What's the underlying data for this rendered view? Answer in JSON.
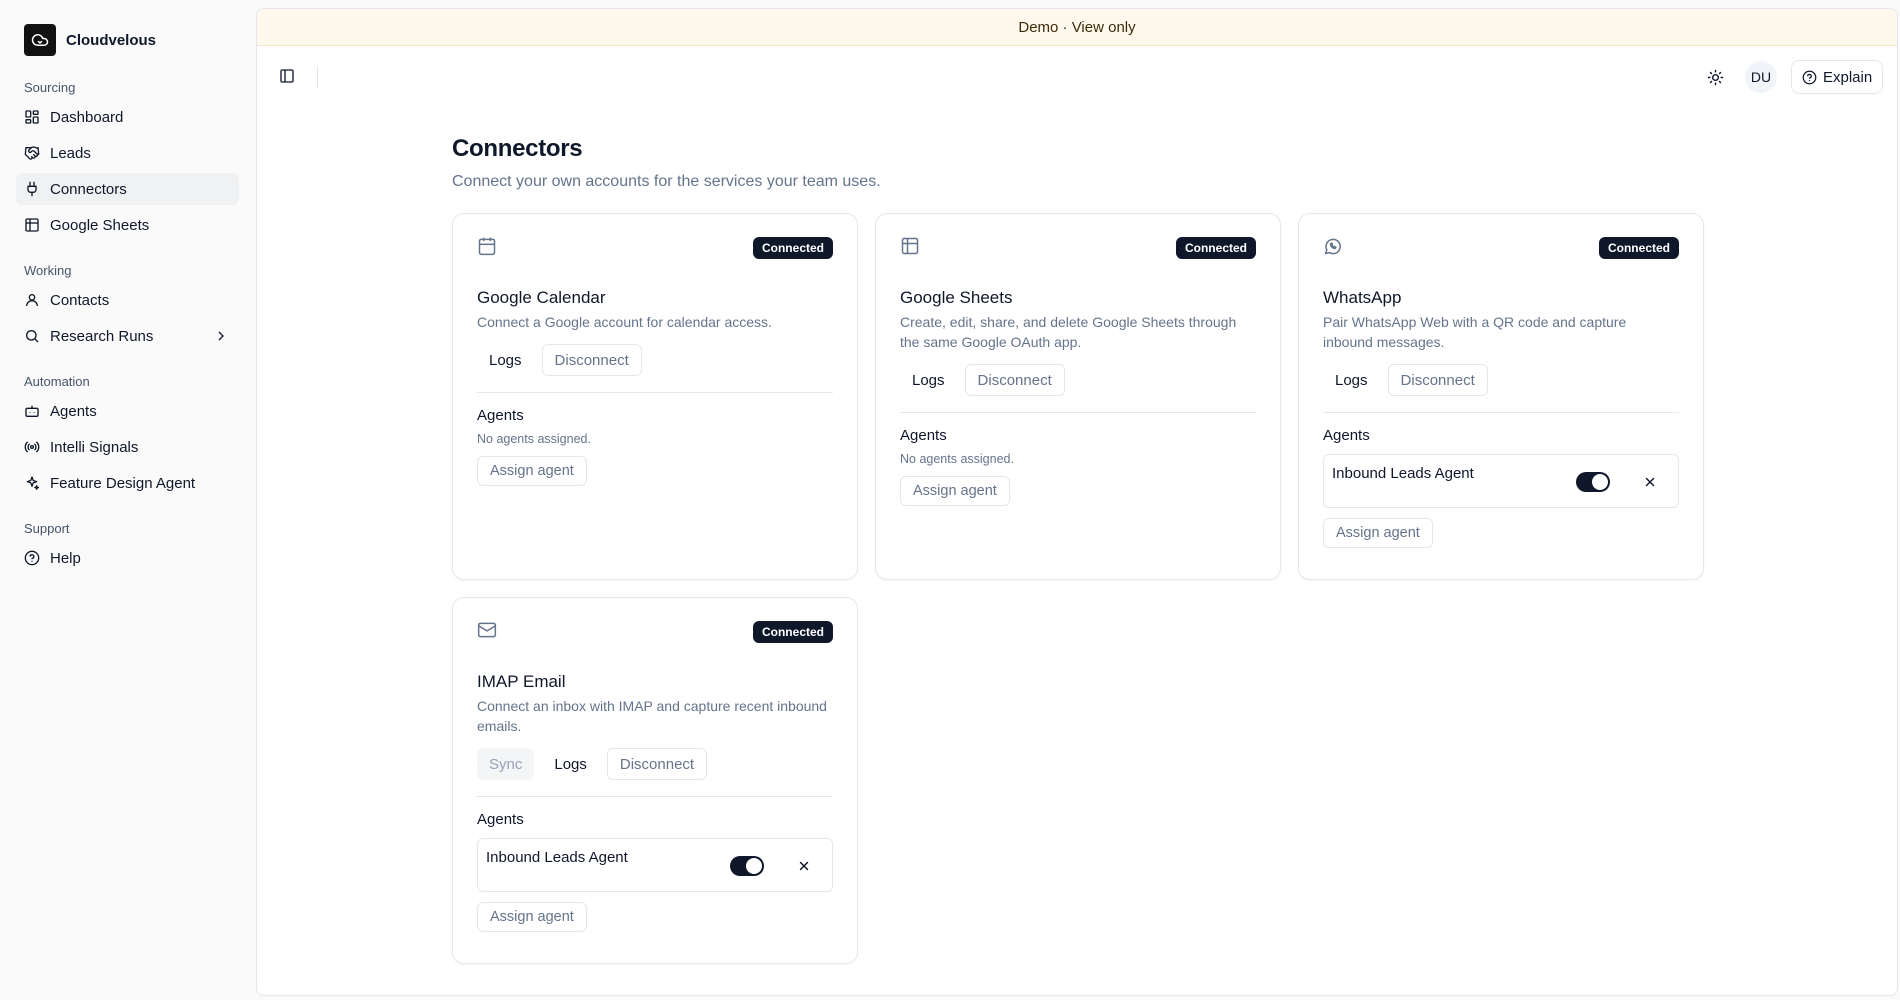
{
  "app": {
    "name": "Cloudvelous"
  },
  "banner": {
    "text": "Demo · View only"
  },
  "sidebar": {
    "groups": [
      {
        "label": "Sourcing",
        "items": [
          {
            "label": "Dashboard",
            "icon": "dashboard-icon"
          },
          {
            "label": "Leads",
            "icon": "leads-icon"
          },
          {
            "label": "Connectors",
            "icon": "plug-icon",
            "active": true
          },
          {
            "label": "Google Sheets",
            "icon": "sheet-icon"
          }
        ]
      },
      {
        "label": "Working",
        "items": [
          {
            "label": "Contacts",
            "icon": "user-icon"
          },
          {
            "label": "Research Runs",
            "icon": "search-icon"
          }
        ]
      },
      {
        "label": "Automation",
        "items": [
          {
            "label": "Agents",
            "icon": "bot-icon"
          },
          {
            "label": "Intelli Signals",
            "icon": "signal-icon"
          },
          {
            "label": "Feature Design Agent",
            "icon": "sparkles-icon"
          }
        ]
      },
      {
        "label": "Support",
        "items": [
          {
            "label": "Help",
            "icon": "help-icon"
          }
        ]
      }
    ]
  },
  "header": {
    "avatar_initials": "DU",
    "explain_label": "Explain"
  },
  "page": {
    "title": "Connectors",
    "subtitle": "Connect your own accounts for the services your team uses."
  },
  "labels": {
    "connected": "Connected",
    "logs": "Logs",
    "disconnect": "Disconnect",
    "sync": "Sync",
    "agents": "Agents",
    "no_agents": "No agents assigned.",
    "assign_agent": "Assign agent"
  },
  "connectors": [
    {
      "title": "Google Calendar",
      "desc": "Connect a Google account for calendar access.",
      "icon": "calendar-icon",
      "agent": ""
    },
    {
      "title": "Google Sheets",
      "desc": "Create, edit, share, and delete Google Sheets through the same Google OAuth app.",
      "icon": "sheet-icon",
      "agent": ""
    },
    {
      "title": "WhatsApp",
      "desc": "Pair WhatsApp Web with a QR code and capture inbound messages.",
      "icon": "whatsapp-icon",
      "agent": "Inbound Leads Agent"
    },
    {
      "title": "IMAP Email",
      "desc": "Connect an inbox with IMAP and capture recent inbound emails.",
      "icon": "mail-icon",
      "agent": "Inbound Leads Agent"
    }
  ]
}
